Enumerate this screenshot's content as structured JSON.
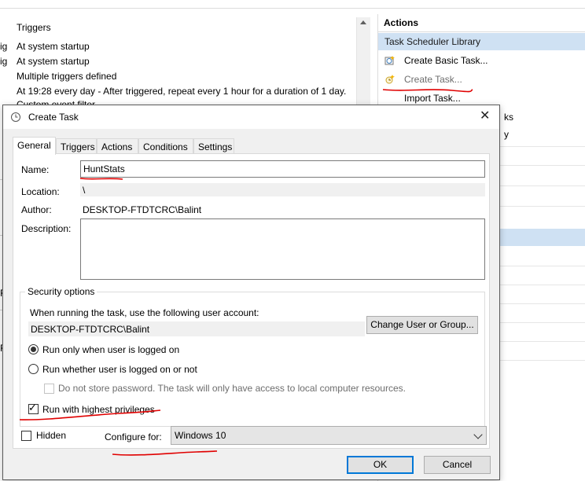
{
  "background": {
    "triggers_header": "Triggers",
    "cut_fragments": [
      "ig",
      "ig",
      "F",
      "F"
    ],
    "trigger_rows": [
      "At system startup",
      "At system startup",
      "Multiple triggers defined",
      "At 19:28 every day - After triggered, repeat every 1 hour for a duration of 1 day.",
      "Custom event filter"
    ],
    "actions_panel": {
      "title": "Actions",
      "library": "Task Scheduler Library",
      "items": [
        "Create Basic Task...",
        "Create Task...",
        "Import Task..."
      ],
      "fragments": [
        "ks",
        "y"
      ]
    }
  },
  "dialog": {
    "title": "Create Task",
    "close_glyph": "✕",
    "tabs": [
      "General",
      "Triggers",
      "Actions",
      "Conditions",
      "Settings"
    ],
    "active_tab": "General",
    "name_label": "Name:",
    "name_value": "HuntStats",
    "location_label": "Location:",
    "location_value": "\\",
    "author_label": "Author:",
    "author_value": "DESKTOP-FTDTCRC\\Balint",
    "description_label": "Description:",
    "description_value": "",
    "security": {
      "legend": "Security options",
      "account_prompt": "When running the task, use the following user account:",
      "account_value": "DESKTOP-FTDTCRC\\Balint",
      "change_button": "Change User or Group...",
      "radio_logged_on": "Run only when user is logged on",
      "radio_whether": "Run whether user is logged on or not",
      "radio_selected": "logged_on",
      "no_store_password": "Do not store password.  The task will only have access to local computer resources.",
      "highest_privileges": "Run with highest privileges",
      "highest_privileges_checked": true
    },
    "hidden_label": "Hidden",
    "hidden_checked": false,
    "configure_label": "Configure for:",
    "configure_value": "Windows 10",
    "ok_button": "OK",
    "cancel_button": "Cancel"
  },
  "colors": {
    "annotation_red": "#e00000",
    "selection_blue": "#cfe1f3",
    "primary_border": "#0078d7"
  }
}
